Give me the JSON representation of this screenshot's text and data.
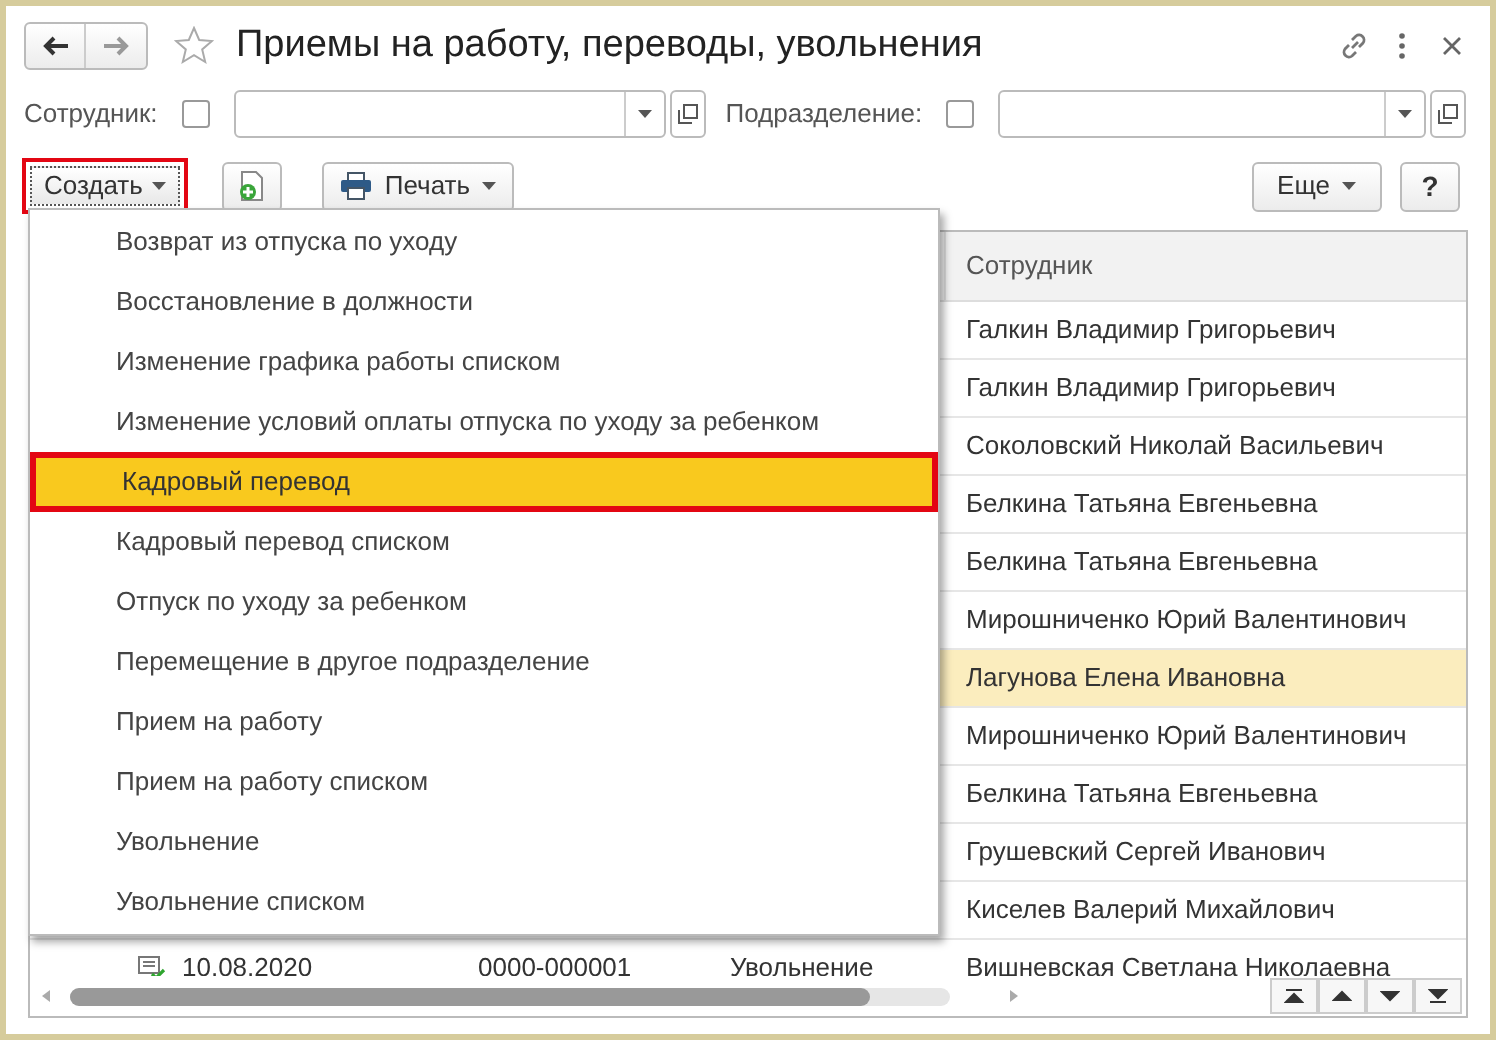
{
  "window": {
    "title": "Приемы на работу, переводы, увольнения"
  },
  "filters": [
    {
      "label": "Сотрудник:",
      "checked": false
    },
    {
      "label": "Подразделение:",
      "checked": false
    }
  ],
  "toolbar": {
    "create": {
      "label": "Создать",
      "highlighted": true
    },
    "print": {
      "label": "Печать"
    },
    "more": {
      "label": "Еще"
    },
    "help": {
      "label": "?"
    }
  },
  "menu": [
    {
      "label": "Возврат из отпуска по уходу",
      "selected": false
    },
    {
      "label": "Восстановление в должности",
      "selected": false
    },
    {
      "label": "Изменение графика работы списком",
      "selected": false
    },
    {
      "label": "Изменение условий оплаты отпуска по уходу за ребенком",
      "selected": false
    },
    {
      "label": "Кадровый перевод",
      "selected": true
    },
    {
      "label": "Кадровый перевод списком",
      "selected": false
    },
    {
      "label": "Отпуск по уходу за ребенком",
      "selected": false
    },
    {
      "label": "Перемещение в другое подразделение",
      "selected": false
    },
    {
      "label": "Прием на работу",
      "selected": false
    },
    {
      "label": "Прием на работу списком",
      "selected": false
    },
    {
      "label": "Увольнение",
      "selected": false
    },
    {
      "label": "Увольнение списком",
      "selected": false
    }
  ],
  "table": {
    "columns": [
      {
        "label": "Сотрудник"
      }
    ],
    "rows": [
      {
        "employee": "Галкин Владимир Григорьевич",
        "selected": false
      },
      {
        "employee": "Галкин Владимир Григорьевич",
        "selected": false
      },
      {
        "employee": "Соколовский Николай Васильевич",
        "selected": false
      },
      {
        "employee": "Белкина Татьяна Евгеньевна",
        "selected": false
      },
      {
        "employee": "Белкина Татьяна Евгеньевна",
        "selected": false
      },
      {
        "employee": "Мирошниченко Юрий Валентинович",
        "selected": false
      },
      {
        "employee": "Лагунова Елена Ивановна",
        "selected": true
      },
      {
        "employee": "Мирошниченко Юрий Валентинович",
        "selected": false
      },
      {
        "employee": "Белкина Татьяна Евгеньевна",
        "selected": false
      },
      {
        "employee": "Грушевский Сергей Иванович",
        "selected": false
      },
      {
        "employee": "Киселев Валерий Михайлович",
        "selected": false
      },
      {
        "posted": true,
        "date": "10.08.2020",
        "number": "0000-000001",
        "type": "Увольнение",
        "employee": "Вишневская Светлана Николаевна",
        "selected": false
      }
    ]
  }
}
